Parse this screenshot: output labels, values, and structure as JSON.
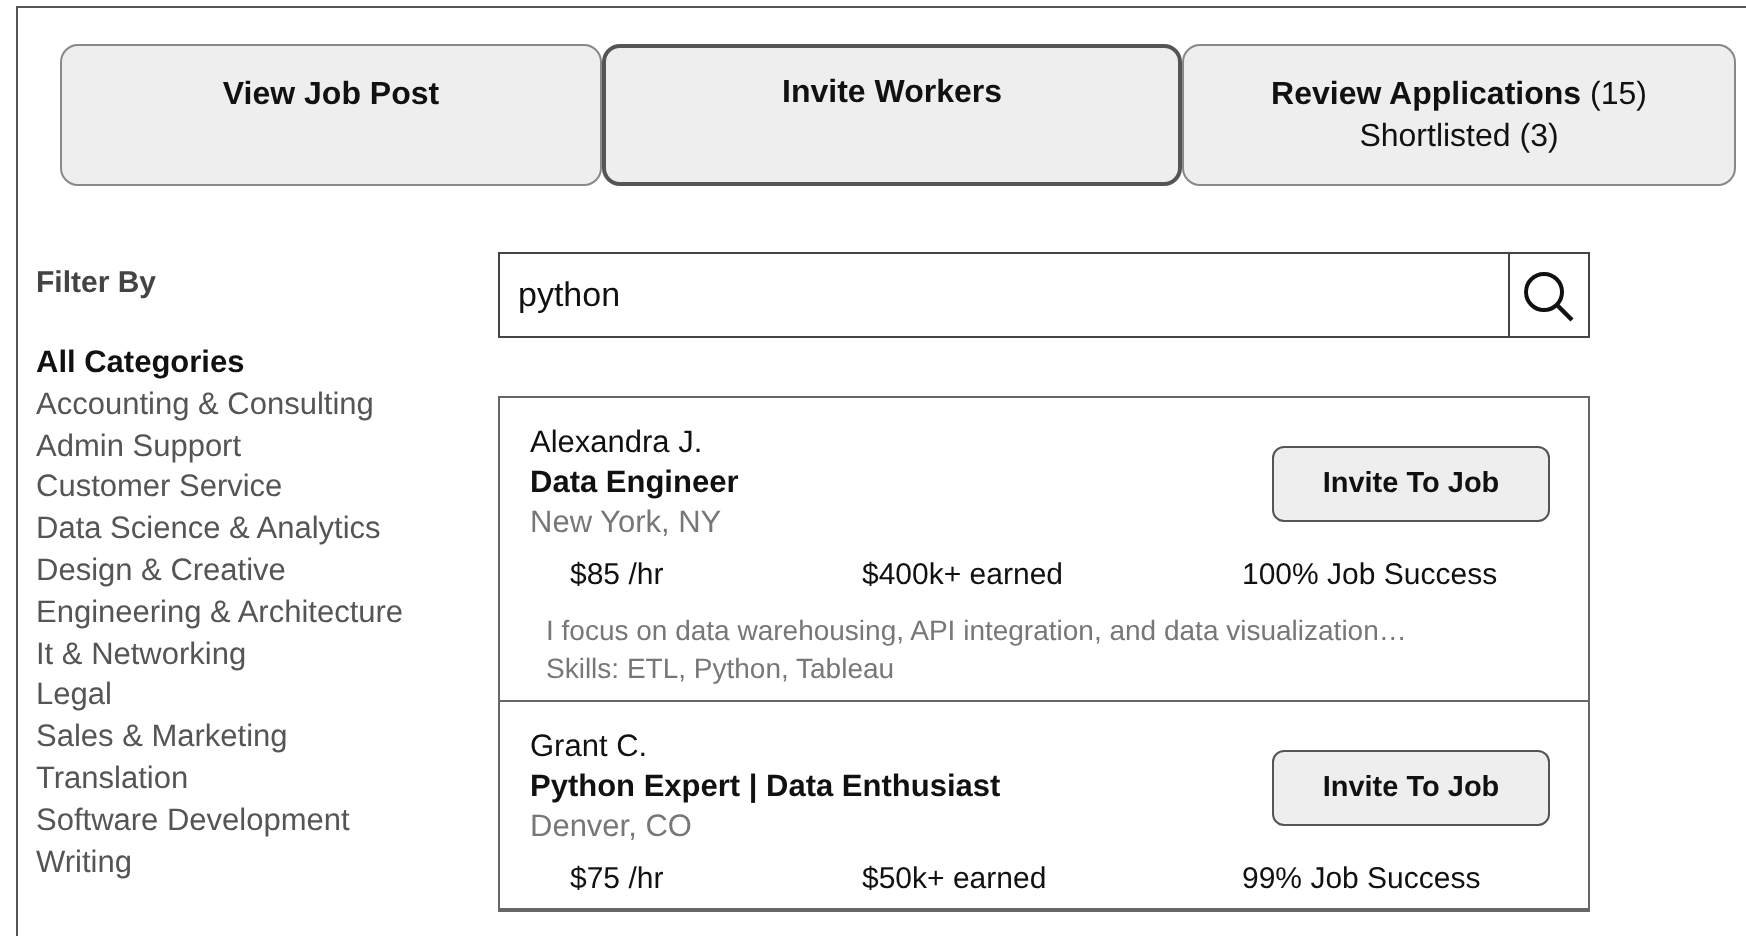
{
  "tabs": [
    {
      "label": "View Job Post",
      "selected": false
    },
    {
      "label": "Invite Workers",
      "selected": true
    },
    {
      "label": "**Review Applications** (15)",
      "sublabel": "Shortlisted (3)",
      "selected": false
    }
  ],
  "filter": {
    "title": "Filter By",
    "categories": [
      {
        "label": "All Categories",
        "selected": true
      },
      {
        "label": "Accounting & Consulting",
        "selected": false
      },
      {
        "label": "Admin Support",
        "selected": false
      },
      {
        "label": "Customer Service",
        "selected": false
      },
      {
        "label": "Data Science & Analytics",
        "selected": false
      },
      {
        "label": "Design & Creative",
        "selected": false
      },
      {
        "label": "Engineering & Architecture",
        "selected": false
      },
      {
        "label": "It & Networking",
        "selected": false
      },
      {
        "label": "Legal",
        "selected": false
      },
      {
        "label": "Sales & Marketing",
        "selected": false
      },
      {
        "label": "Translation",
        "selected": false
      },
      {
        "label": "Software Development",
        "selected": false
      },
      {
        "label": "Writing",
        "selected": false
      }
    ]
  },
  "search": {
    "value": "python"
  },
  "results": [
    {
      "name": "Alexandra J.",
      "title": "Data Engineer",
      "location": "New York, NY",
      "rate": "$85 /hr",
      "earned": "$400k+ earned",
      "success": "100% Job Success",
      "description": "I focus on data warehousing, API integration, and data visualization…",
      "skills": "Skills: ETL, Python, Tableau",
      "button": "Invite To Job"
    },
    {
      "name": "Grant C.",
      "title": "Python Expert | Data Enthusiast",
      "location": "Denver, CO",
      "rate": "$75 /hr",
      "earned": "$50k+ earned",
      "success": "99% Job Success",
      "button": "Invite To Job"
    }
  ]
}
